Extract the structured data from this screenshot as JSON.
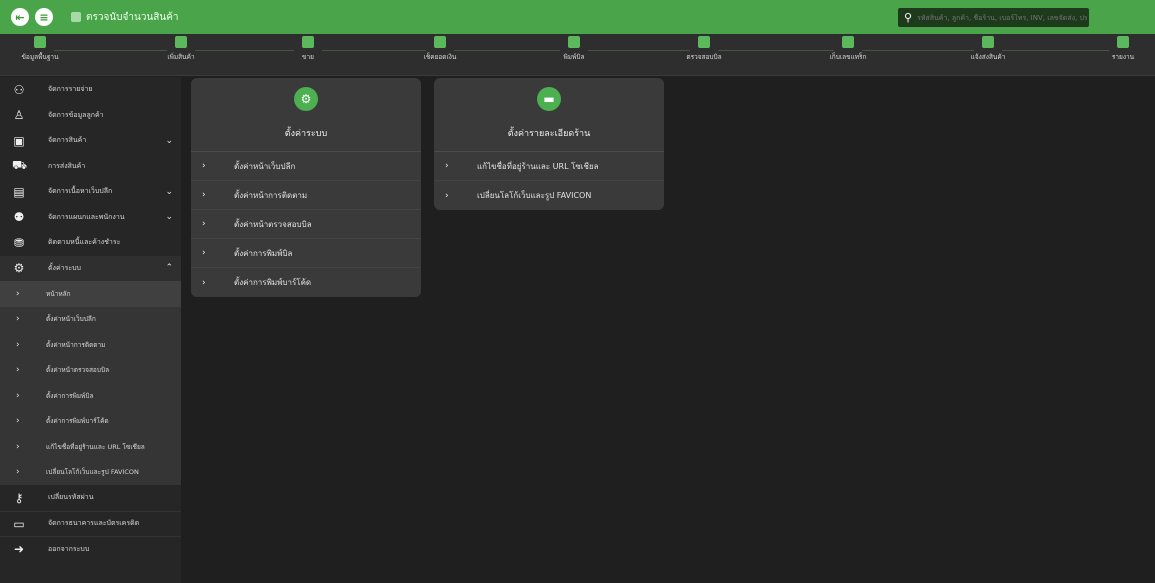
{
  "topbar": {
    "title": "ตรวจนับจำนวนสินค้า",
    "search_placeholder": "รหัสสินค้า, ลูกค้า, ชื่อร้าน, เบอร์โทร, INV, เลขจัดส่ง, ประ..."
  },
  "toolbar": [
    "ข้อมูลพื้นฐาน",
    "เพิ่มสินค้า",
    "ขาย",
    "เช็คยอดเงิน",
    "พิมพ์บิล",
    "ตรวจสอบบิล",
    "เก็บเลขแทร็ก",
    "แจ้งส่งสินค้า",
    "รายงาน"
  ],
  "sidebar": {
    "items": [
      {
        "icon": "money-icon",
        "glyph": "⚇",
        "label": "จัดการรายจ่าย",
        "chevron": ""
      },
      {
        "icon": "user-icon",
        "glyph": "♙",
        "label": "จัดการข้อมูลลูกค้า",
        "chevron": ""
      },
      {
        "icon": "box-icon",
        "glyph": "▣",
        "label": "จัดการสินค้า",
        "chevron": "⌄"
      },
      {
        "icon": "truck-icon",
        "glyph": "⛟",
        "label": "การส่งสินค้า",
        "chevron": ""
      },
      {
        "icon": "invoice-icon",
        "glyph": "▤",
        "label": "จัดการเนื้อหาเว็บปลีก",
        "chevron": "⌄"
      },
      {
        "icon": "staff-icon",
        "glyph": "⚉",
        "label": "จัดการแผนกและพนักงาน",
        "chevron": "⌄"
      },
      {
        "icon": "coins-icon",
        "glyph": "⛃",
        "label": "ติดตามหนี้และค้างชำระ",
        "chevron": ""
      },
      {
        "icon": "gear-icon",
        "glyph": "⚙",
        "label": "ตั้งค่าระบบ",
        "chevron": "⌃"
      }
    ],
    "sub_items": [
      "หน้าหลัก",
      "ตั้งค่าหน้าเว็บปลีก",
      "ตั้งค่าหน้าการติดตาม",
      "ตั้งค่าหน้าตรวจสอบบิล",
      "ตั้งค่าการพิมพ์บิล",
      "ตั้งค่าการพิมพ์บาร์โค้ด",
      "แก้ไขชื่อที่อยู่ร้านและ URL โซเชียล",
      "เปลี่ยนโลโก้เว็บและรูป FAVICON"
    ],
    "bottom_items": [
      {
        "icon": "key-icon",
        "glyph": "⚷",
        "label": "เปลี่ยนรหัสผ่าน"
      },
      {
        "icon": "card-icon",
        "glyph": "▭",
        "label": "จัดการธนาคารและบัตรเครดิต"
      },
      {
        "icon": "logout-icon",
        "glyph": "➜",
        "label": "ออกจากระบบ"
      }
    ]
  },
  "cards": [
    {
      "icon": "settings-icon",
      "title": "ตั้งค่าระบบ",
      "rows": [
        "ตั้งค่าหน้าเว็บปลีก",
        "ตั้งค่าหน้าการติดตาม",
        "ตั้งค่าหน้าตรวจสอบบิล",
        "ตั้งค่าการพิมพ์บิล",
        "ตั้งค่าการพิมพ์บาร์โค้ด"
      ]
    },
    {
      "icon": "store-icon",
      "title": "ตั้งค่ารายละเอียดร้าน",
      "rows": [
        "แก้ไขชื่อที่อยู่ร้านและ URL โซเชียล",
        "เปลี่ยนโลโก้เว็บและรูป FAVICON"
      ]
    }
  ]
}
